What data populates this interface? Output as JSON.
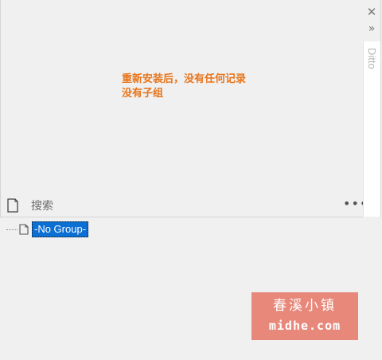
{
  "window": {
    "side_title": "Ditto",
    "close_glyph": "✕",
    "expand_glyph": "»",
    "more_glyph": "•••"
  },
  "annotation": {
    "line1": "重新安装后，没有任何记录",
    "line2": "没有子组"
  },
  "search": {
    "placeholder": "搜索",
    "value": ""
  },
  "groups": {
    "items": [
      {
        "label": "-No Group-",
        "selected": true
      }
    ]
  },
  "watermark": {
    "name": "春溪小镇",
    "url": "midhe.com"
  },
  "colors": {
    "annotation": "#e8741a",
    "selection": "#0b6fd4",
    "watermark_bg": "#e8887a"
  },
  "icons": {
    "close": "close-icon",
    "expand": "double-chevron-right-icon",
    "search_note": "note-icon",
    "more": "more-icon",
    "tree_note": "note-icon"
  }
}
